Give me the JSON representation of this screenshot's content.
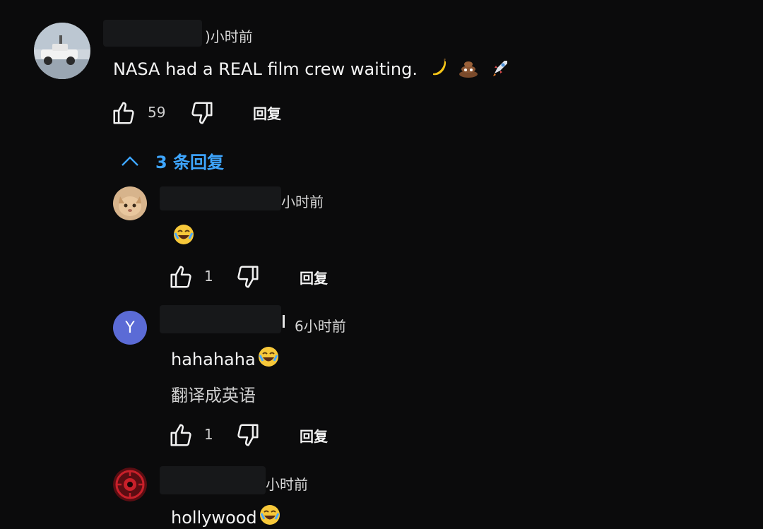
{
  "colors": {
    "background": "#0b0b0c",
    "accent": "#3ea6ff",
    "avatar_y": "#5b6bd6",
    "text": "#f1f1f1"
  },
  "main_comment": {
    "time": ")小时前",
    "text": "NASA had a REAL film crew waiting.",
    "emojis": [
      "banana-emoji",
      "poop-emoji",
      "rocket-emoji"
    ],
    "likes": "59",
    "reply_label": "回复"
  },
  "replies_toggle": {
    "label": "3 条回复",
    "icon": "chevron-up-icon"
  },
  "replies": [
    {
      "time": "小时前",
      "text": "",
      "emoji": "laughing-emoji",
      "likes": "1",
      "reply_label": "回复"
    },
    {
      "avatar_letter": "Y",
      "time": "6小时前",
      "text": "hahahaha",
      "emoji": "laughing-emoji",
      "translate": "翻译成英语",
      "likes": "1",
      "reply_label": "回复"
    },
    {
      "time": "小时前",
      "text": "hollywood",
      "emoji": "laughing-emoji"
    }
  ]
}
